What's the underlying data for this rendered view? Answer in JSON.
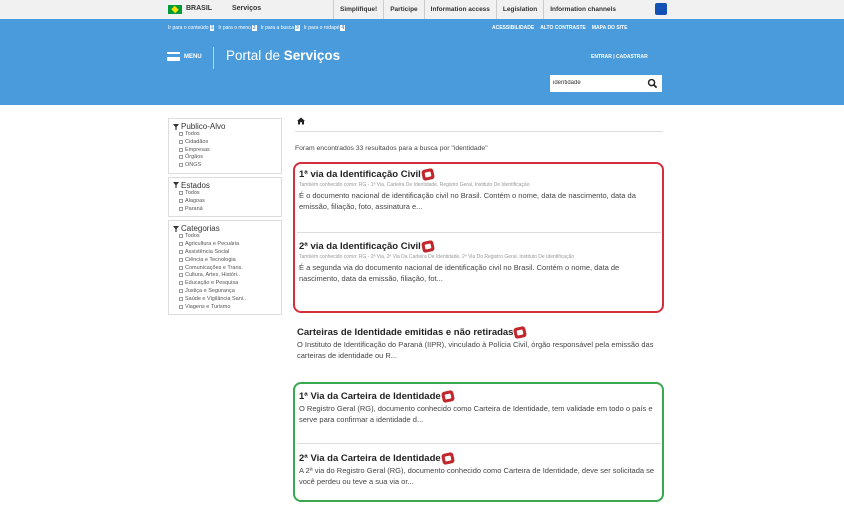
{
  "govbar": {
    "brasil": "BRASIL",
    "services": "Serviços",
    "links": [
      "Simplifique!",
      "Participe",
      "Information access",
      "Legislation",
      "Information channels"
    ]
  },
  "accessibility": {
    "left": [
      "Ir para o conteúdo",
      "1",
      "Ir para o menu",
      "2",
      "Ir para a busca",
      "3",
      "Ir para o rodapé",
      "4"
    ],
    "right": [
      "ACESSIBILIDADE",
      "ALTO CONTRASTE",
      "MAPA DO SITE"
    ]
  },
  "header": {
    "menu_label": "MENU",
    "portal_prefix": "Portal de ",
    "portal_bold": "Serviços",
    "login": "ENTRAR | CADASTRAR"
  },
  "search": {
    "value": "identidade"
  },
  "filters": [
    {
      "title": "Publico-Alvo",
      "items": [
        "Todos",
        "Cidadãos",
        "Empresas",
        "Órgãos",
        "ONGS"
      ]
    },
    {
      "title": "Estados",
      "items": [
        "Todos",
        "Alagoas",
        "Paraná"
      ]
    },
    {
      "title": "Categorias",
      "items": [
        "Todos",
        "Agricultura e Pecuária",
        "Assistência Social",
        "Ciência e Tecnologia",
        "Comunicações e Trans.",
        "Cultura, Artes, Históri..",
        "Educação e Pesquisa",
        "Justiça e Segurança",
        "Saúde e Vigilância Sani..",
        "Viagens e Turismo"
      ]
    }
  ],
  "results_count": "Foram encontrados 33 resultados para a busca por \"identidade\"",
  "results": [
    {
      "title": "1ª via da Identificação Civil",
      "aka": "Também conhecido como: RG - 1ª Via, Carteira De Identidade, Registro Geral, Instituto De Identificação",
      "desc": "É o documento nacional de identificação civil no Brasil. Contém o nome, data de nascimento, data da emissão, filiação, foto, assinatura e..."
    },
    {
      "title": "2ª via da Identificação Civil",
      "aka": "Também conhecido como: RG - 2ª Via, 2ª Via Da Carteira De Identidade, 2ª Via Do Registro Geral, Instituto De Identificação",
      "desc": "É a segunda via do documento nacional de identificação civil no Brasil. Contém o nome, data de nascimento, data da emissão, filiação, fot..."
    },
    {
      "title": "Carteiras de Identidade emitidas e não retiradas",
      "aka": "",
      "desc": "O Instituto de Identificação do Paraná (IIPR), vinculado à Polícia Civil, órgão responsável pela emissão das carteiras de identidade ou R..."
    },
    {
      "title": "1ª Via da Carteira de Identidade",
      "aka": "",
      "desc": "O Registro Geral (RG), documento conhecido como Carteira de Identidade, tem validade em todo o país e serve para confirmar a identidade d..."
    },
    {
      "title": "2ª Via da Carteira de Identidade",
      "aka": "",
      "desc": "A 2ª via do Registro Geral (RG), documento conhecido como Carteira de Identidade, deve ser solicitada se você perdeu ou teve a sua via or..."
    }
  ],
  "colors": {
    "header": "#4a9bdb",
    "highlight_red": "#d32f3c",
    "highlight_green": "#3aa84e",
    "badge": "#c1272d"
  }
}
